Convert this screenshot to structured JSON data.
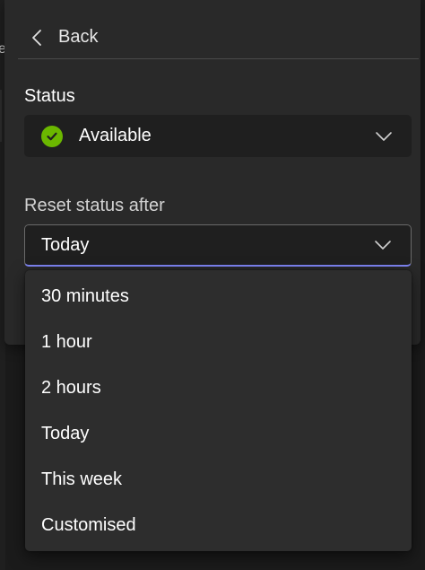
{
  "navigation": {
    "back_label": "Back"
  },
  "status": {
    "label": "Status",
    "value": "Available",
    "indicator_color": "#6bb700"
  },
  "reset": {
    "label": "Reset status after",
    "value": "Today",
    "options": [
      "30 minutes",
      "1 hour",
      "2 hours",
      "Today",
      "This week",
      "Customised"
    ]
  },
  "theme": {
    "accent": "#7f85f5",
    "panel_bg": "#292929",
    "menu_bg": "#2d2d2d"
  }
}
